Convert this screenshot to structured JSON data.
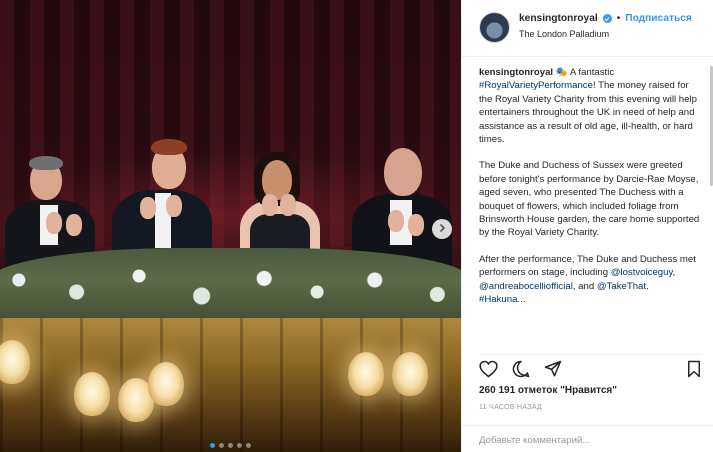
{
  "post": {
    "username": "kensingtonroyal",
    "follow_separator": "•",
    "follow_label": "Подписаться",
    "location": "The London Palladium"
  },
  "caption": {
    "username": "kensingtonroyal",
    "emoji": "🎭",
    "p1_text_a": " A fantastic ",
    "p1_hashtag": "#RoyalVarietyPerformance",
    "p1_text_b": "! The money raised for the Royal Variety Charity from this evening will help entertainers throughout the UK in need of help and assistance as a result of old age, ill-health, or hard times.",
    "p2": "The Duke and Duchess of Sussex were greeted before tonight's performance by Darcie-Rae Moyse, aged seven, who presented The Duchess with a bouquet of flowers, which included foliage from Brinsworth House garden, the care home supported by the Royal Variety Charity.",
    "p3_text_a": "After the performance, The Duke and Duchess met performers on stage, including ",
    "p3_mention_1": "@lostvoiceguy",
    "p3_sep_1": ", ",
    "p3_mention_2": "@andreabocelliofficial",
    "p3_sep_2": ", and ",
    "p3_mention_3": "@TakeThat",
    "p3_end": ".",
    "p4_partial": "#Hakuna..."
  },
  "likes": "260 191 отметок \"Нравится\"",
  "time": "11 ЧАСОВ НАЗАД",
  "comment_placeholder": "Добавьте комментарий...",
  "carousel": {
    "slides": 5,
    "active": 1
  },
  "icons": {
    "like": "heart-icon",
    "comment": "comment-bubble-icon",
    "share": "share-icon",
    "save": "bookmark-icon",
    "next": "chevron-right-icon",
    "verified": "verified-badge-icon"
  },
  "colors": {
    "accent": "#3897f0",
    "link": "#003569",
    "muted": "#999999"
  }
}
